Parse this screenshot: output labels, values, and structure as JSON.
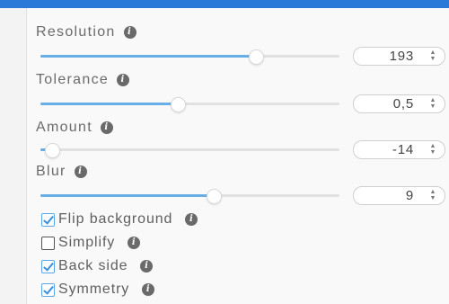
{
  "colors": {
    "accent": "#2a78d8",
    "slider_fill": "#6aaee6",
    "checkbox_tick": "#3a8ee0"
  },
  "info_icon_glyph": "i",
  "spin_arrows": {
    "up": "▲",
    "down": "▼"
  },
  "controls": [
    {
      "label": "Resolution",
      "value": "193",
      "level": 0.72
    },
    {
      "label": "Tolerance",
      "value": "0,5",
      "level": 0.46
    },
    {
      "label": "Amount",
      "value": "-14",
      "level": 0.04
    },
    {
      "label": "Blur",
      "value": "9",
      "level": 0.58
    }
  ],
  "options": [
    {
      "label": "Flip background",
      "checked": true
    },
    {
      "label": "Simplify",
      "checked": false
    },
    {
      "label": "Back side",
      "checked": true
    },
    {
      "label": "Symmetry",
      "checked": true
    }
  ]
}
